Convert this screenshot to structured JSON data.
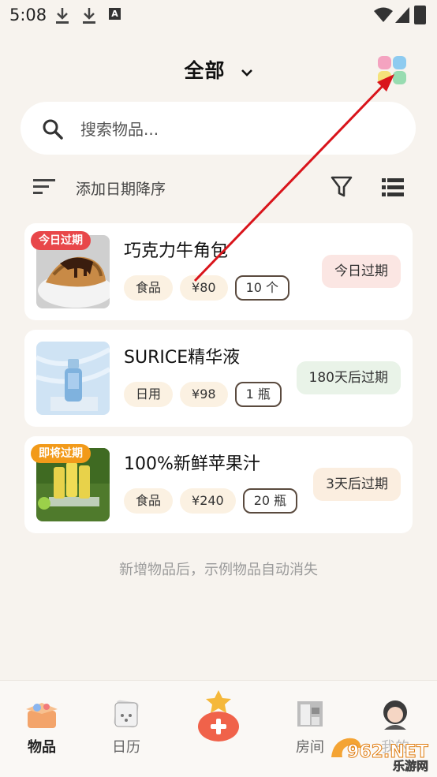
{
  "status_bar": {
    "time": "5:08"
  },
  "header": {
    "title": "全部"
  },
  "search": {
    "placeholder": "搜索物品..."
  },
  "sort": {
    "label": "添加日期降序"
  },
  "items": [
    {
      "name": "巧克力牛角包",
      "badge": "今日过期",
      "badge_color": "#e8474a",
      "tags": [
        "食品",
        "¥80"
      ],
      "quantity": "10 个",
      "status": "今日过期",
      "status_bg": "#fbe6e3"
    },
    {
      "name": "SURICE精华液",
      "badge": "",
      "badge_color": "",
      "tags": [
        "日用",
        "¥98"
      ],
      "quantity": "1 瓶",
      "status": "180天后过期",
      "status_bg": "#e9f3e8"
    },
    {
      "name": "100%新鲜苹果汁",
      "badge": "即将过期",
      "badge_color": "#f29a1a",
      "tags": [
        "食品",
        "¥240"
      ],
      "quantity": "20 瓶",
      "status": "3天后过期",
      "status_bg": "#fbeee0"
    }
  ],
  "hint": "新增物品后，示例物品自动消失",
  "nav": [
    {
      "label": "物品",
      "icon": "storage-box-icon",
      "active": true
    },
    {
      "label": "日历",
      "icon": "calendar-icon",
      "active": false
    },
    {
      "label": "",
      "icon": "add-lucky-bag-icon",
      "active": false
    },
    {
      "label": "房间",
      "icon": "room-icon",
      "active": false
    },
    {
      "label": "我的",
      "icon": "profile-icon",
      "active": false
    }
  ],
  "watermark": {
    "text": "962.NET",
    "subtext": "乐游网"
  },
  "colors": {
    "background": "#f7f3ee",
    "arrow": "#d9141b"
  }
}
